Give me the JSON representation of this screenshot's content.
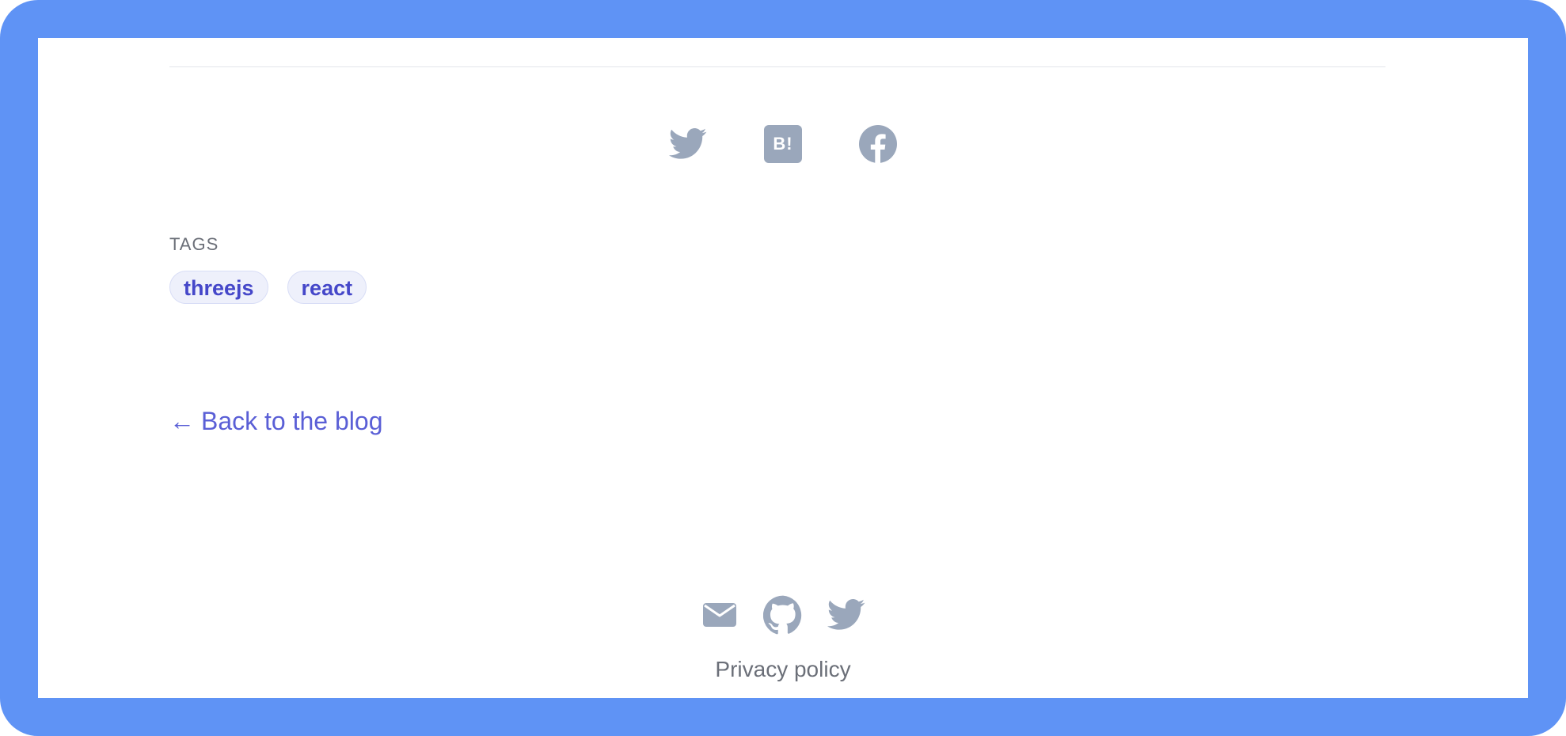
{
  "share": {
    "icons": [
      "twitter-icon",
      "hatena-bookmark-icon",
      "facebook-icon"
    ],
    "hatena_label": "B!"
  },
  "tags": {
    "heading": "TAGS",
    "items": [
      {
        "label": "threejs"
      },
      {
        "label": "react"
      }
    ]
  },
  "navigation": {
    "back_arrow": "←",
    "back_label": "Back to the blog"
  },
  "footer": {
    "icons": [
      "mail-icon",
      "github-icon",
      "twitter-icon"
    ],
    "privacy_label": "Privacy policy"
  },
  "colors": {
    "frame": "#5f93f5",
    "icon": "#9aa7bb",
    "tag_text": "#4547c9",
    "tag_bg": "#eef0fb",
    "link": "#5a5fd6",
    "muted_text": "#6b6f78",
    "divider": "#e3e5ea"
  }
}
